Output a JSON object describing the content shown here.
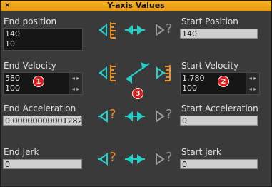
{
  "window": {
    "title": "Y-axis Values",
    "close_glyph": "×"
  },
  "end_position": {
    "label": "End position",
    "value1": "140",
    "value2": "10"
  },
  "start_position": {
    "label": "Start Position",
    "value": "140"
  },
  "end_velocity": {
    "label": "End Velocity",
    "value1": "580",
    "value2": "100",
    "badge": "1"
  },
  "start_velocity": {
    "label": "Start Velocity",
    "value1": "1,780",
    "value2": "100",
    "badge": "2"
  },
  "center_badge": "3",
  "end_acceleration": {
    "label": "End Acceleration",
    "value": "0.00000000001282"
  },
  "start_acceleration": {
    "label": "Start Acceleration",
    "value": "0"
  },
  "end_jerk": {
    "label": "End Jerk",
    "value": "0"
  },
  "start_jerk": {
    "label": "Start Jerk",
    "value": "0"
  },
  "unknown_glyph": "?",
  "colors": {
    "accent": "#f6b324",
    "link": "#22d0c8",
    "badge": "#e01818",
    "orange": "#f09020"
  }
}
